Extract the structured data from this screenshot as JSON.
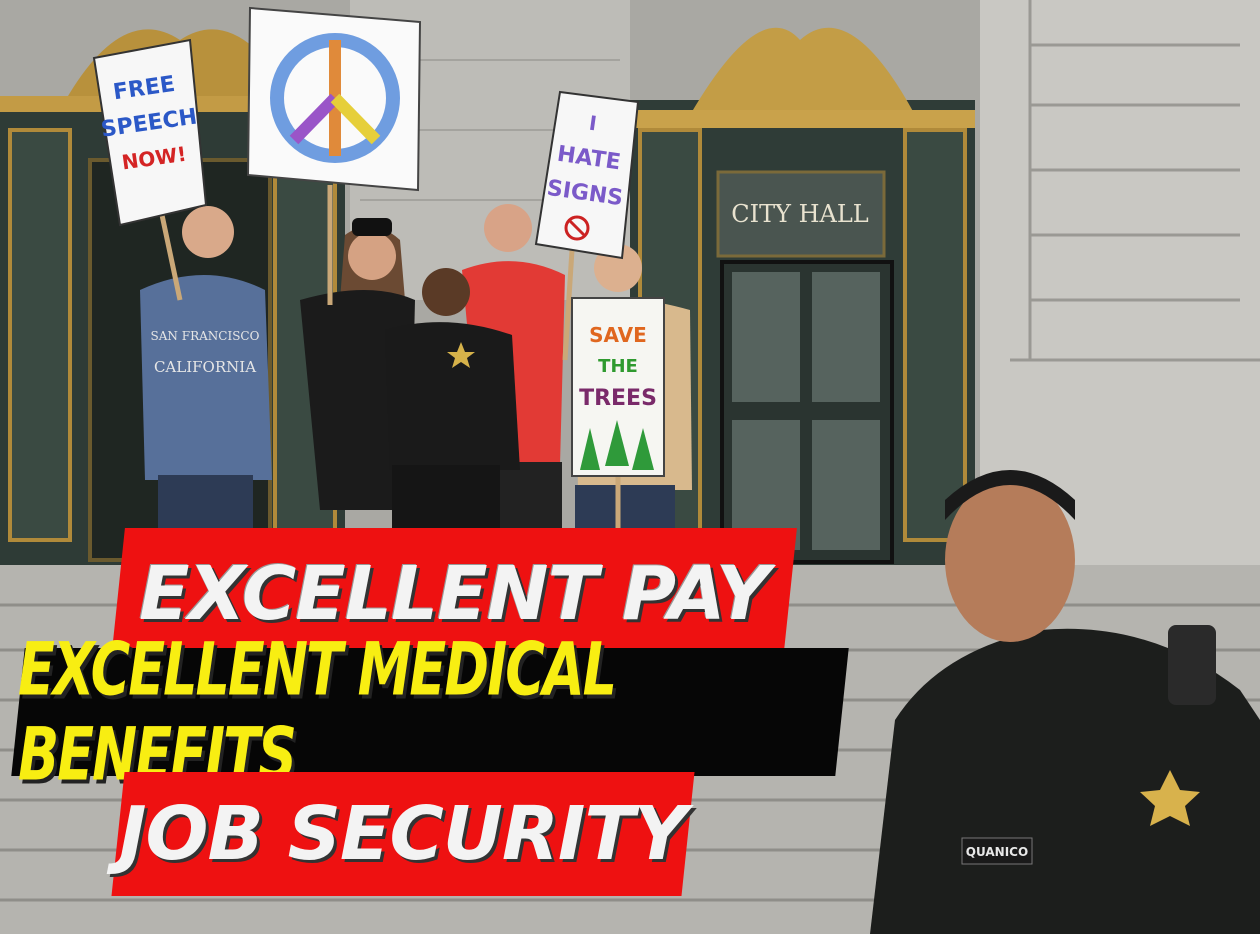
{
  "headline": {
    "line1": "EXCELLENT PAY",
    "line2": "EXCELLENT MEDICAL BENEFITS",
    "line3": "JOB SECURITY"
  },
  "signs": {
    "free_speech": [
      "FREE",
      "SPEECH",
      "NOW!"
    ],
    "hate_signs": [
      "I",
      "HATE",
      "SIGNS"
    ],
    "save_trees": [
      "SAVE",
      "THE",
      "TREES"
    ]
  },
  "building_sign": "CITY HALL",
  "sweatshirt_text": [
    "SAN FRANCISCO",
    "CALIFORNIA"
  ],
  "name_tag": "QUANICO",
  "colors": {
    "banner_red": "#ee1111",
    "banner_black": "#060606",
    "banner_yellow_text": "#f8ee12",
    "banner_white_text": "#f3f3f3"
  }
}
